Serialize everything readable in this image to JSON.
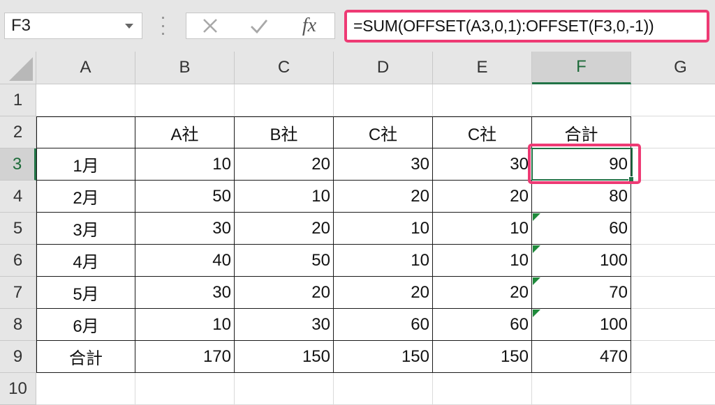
{
  "formula_bar": {
    "name_box": "F3",
    "formula": "=SUM(OFFSET(A3,0,1):OFFSET(F3,0,-1))",
    "fx_label": "fx",
    "cancel_icon": "cancel-x-icon",
    "enter_icon": "enter-check-icon"
  },
  "grid": {
    "columns": [
      "A",
      "B",
      "C",
      "D",
      "E",
      "F",
      "G"
    ],
    "selected_column": "F",
    "rows": [
      "1",
      "2",
      "3",
      "4",
      "5",
      "6",
      "7",
      "8",
      "9",
      "10"
    ],
    "selected_row": "3",
    "header_row": [
      "",
      "A社",
      "B社",
      "C社",
      "C社",
      "合計"
    ],
    "data_rows": [
      {
        "label": "1月",
        "values": [
          "10",
          "20",
          "30",
          "30",
          "90"
        ]
      },
      {
        "label": "2月",
        "values": [
          "50",
          "10",
          "20",
          "20",
          "80"
        ]
      },
      {
        "label": "3月",
        "values": [
          "30",
          "20",
          "10",
          "10",
          "60"
        ]
      },
      {
        "label": "4月",
        "values": [
          "40",
          "50",
          "10",
          "10",
          "100"
        ]
      },
      {
        "label": "5月",
        "values": [
          "30",
          "20",
          "20",
          "20",
          "70"
        ]
      },
      {
        "label": "6月",
        "values": [
          "10",
          "30",
          "60",
          "60",
          "100"
        ]
      },
      {
        "label": "合計",
        "values": [
          "170",
          "150",
          "150",
          "150",
          "470"
        ]
      }
    ],
    "active_cell": "F3",
    "error_indicator_rows": [
      5,
      6,
      7,
      8
    ]
  },
  "colors": {
    "highlight": "#ee3a74",
    "selection": "#217346",
    "error_indicator": "#1f8a3b",
    "header_bg": "#e6e6e6"
  }
}
